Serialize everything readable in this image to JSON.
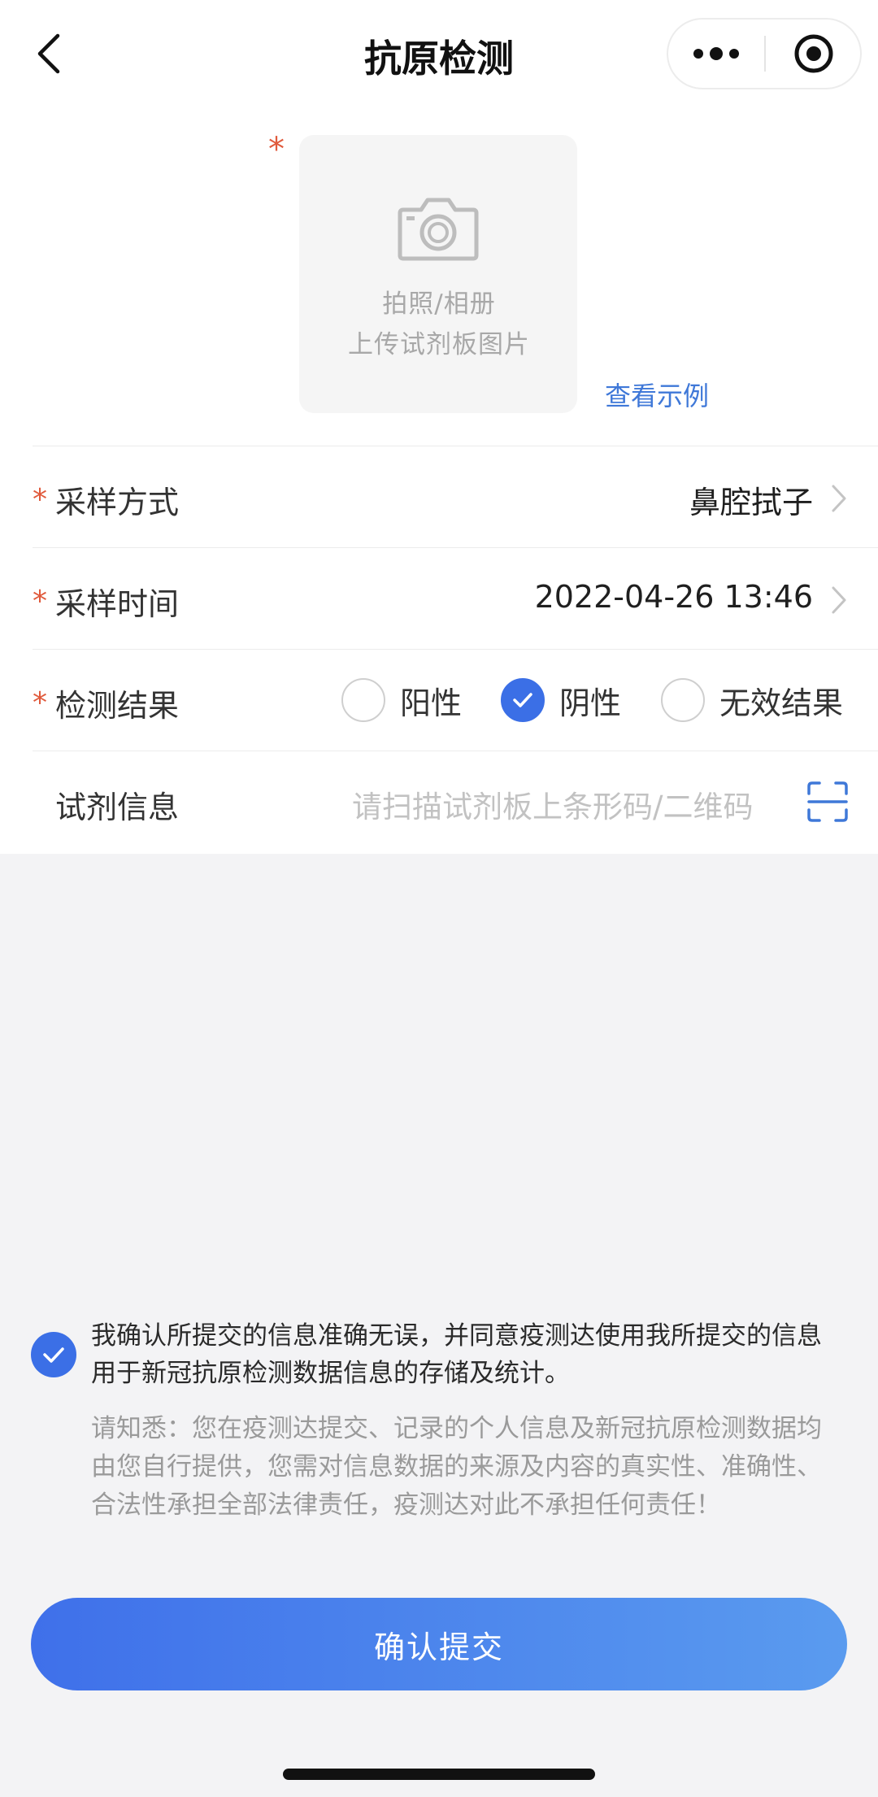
{
  "nav": {
    "title": "抗原检测"
  },
  "upload": {
    "line1": "拍照/相册",
    "line2": "上传试剂板图片",
    "example_link": "查看示例"
  },
  "form": {
    "sampling_method": {
      "label": "采样方式",
      "value": "鼻腔拭子"
    },
    "sampling_time": {
      "label": "采样时间",
      "value": "2022-04-26 13:46"
    },
    "result": {
      "label": "检测结果",
      "options": [
        {
          "label": "阳性",
          "selected": false
        },
        {
          "label": "阴性",
          "selected": true
        },
        {
          "label": "无效结果",
          "selected": false
        }
      ]
    },
    "reagent": {
      "label": "试剂信息",
      "placeholder": "请扫描试剂板上条形码/二维码"
    }
  },
  "agreement": {
    "checked": true,
    "text": "我确认所提交的信息准确无误，并同意疫测达使用我所提交的信息用于新冠抗原检测数据信息的存储及统计。",
    "notice": "请知悉：您在疫测达提交、记录的个人信息及新冠抗原检测数据均由您自行提供，您需对信息数据的来源及内容的真实性、准确性、合法性承担全部法律责任，疫测达对此不承担任何责任！"
  },
  "submit_label": "确认提交",
  "colors": {
    "accent": "#3b6fe6",
    "required_star": "#e05a3c",
    "link": "#3f78d8"
  }
}
